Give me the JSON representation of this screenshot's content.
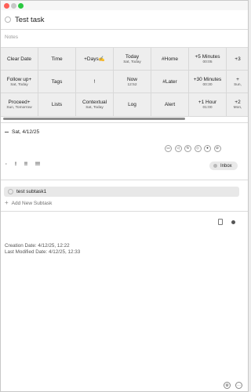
{
  "task": {
    "title": "Test task"
  },
  "notes_placeholder": "Notes",
  "quick_actions": [
    {
      "label": "Clear Date",
      "sub": ""
    },
    {
      "label": "Time",
      "sub": ""
    },
    {
      "label": "+Days✍️",
      "sub": ""
    },
    {
      "label": "Today",
      "sub": "Sat, Today"
    },
    {
      "label": "#Home",
      "sub": ""
    },
    {
      "label": "+5 Minutes",
      "sub": "00:05"
    },
    {
      "label": "+3",
      "sub": ""
    },
    {
      "label": "Follow up+",
      "sub": "Sat, Today"
    },
    {
      "label": "Tags",
      "sub": ""
    },
    {
      "label": "!",
      "sub": ""
    },
    {
      "label": "Now",
      "sub": "12:52"
    },
    {
      "label": "#Later",
      "sub": ""
    },
    {
      "label": "+30 Minutes",
      "sub": "00:30"
    },
    {
      "label": "+",
      "sub": "Sun,"
    },
    {
      "label": "Proceed+",
      "sub": "Sun, Tomorrow"
    },
    {
      "label": "Lists",
      "sub": ""
    },
    {
      "label": "Contextual",
      "sub": "Sat, Today"
    },
    {
      "label": "Log",
      "sub": ""
    },
    {
      "label": "Alert",
      "sub": ""
    },
    {
      "label": "+1 Hour",
      "sub": "01:00"
    },
    {
      "label": "+2",
      "sub": "Mon,"
    }
  ],
  "due": {
    "date": "Sat, 4/12/25"
  },
  "attribute_icons": [
    "calendar-icon",
    "speaker-icon",
    "repeat-icon",
    "tag-icon",
    "location-pin-icon",
    "paperclip-icon"
  ],
  "priorities": [
    "·",
    "!",
    "!!",
    "!!!"
  ],
  "list_badge": {
    "label": "Inbox"
  },
  "subtasks": [
    {
      "title": "test subtask1"
    }
  ],
  "add_subtask_label": "Add New Subtask",
  "meta": {
    "created": "Creation Date: 4/12/25, 12:22",
    "modified": "Last Modified Date: 4/12/25, 12:33"
  },
  "colors": {
    "close": "#fe5f57",
    "minimize": "#c6c6c6",
    "zoom": "#2ac840"
  }
}
